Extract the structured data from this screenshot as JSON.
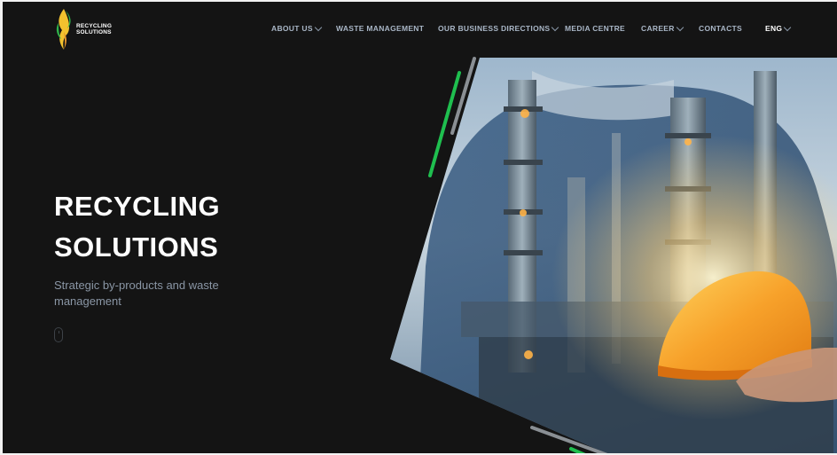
{
  "logo": {
    "line1": "RECYCLING",
    "line2": "SOLUTIONS",
    "icon": "leaf-flame-icon"
  },
  "nav": {
    "items": [
      {
        "label": "ABOUT US",
        "dropdown": true
      },
      {
        "label": "WASTE MANAGEMENT",
        "dropdown": false
      },
      {
        "label": "OUR BUSINESS DIRECTIONS",
        "dropdown": true
      },
      {
        "label": "MEDIA CENTRE",
        "dropdown": false
      },
      {
        "label": "CAREER",
        "dropdown": true
      },
      {
        "label": "CONTACTS",
        "dropdown": false
      }
    ],
    "language": "ENG"
  },
  "hero": {
    "title_line1": "RECYCLING",
    "title_line2": "SOLUTIONS",
    "subtitle": "Strategic by-products and waste management",
    "scroll_icon": "mouse-scroll-icon",
    "image": "worker-with-hard-hat-over-refinery-double-exposure"
  },
  "colors": {
    "background": "#141414",
    "nav_text": "#a9b6c6",
    "accent_green": "#22c55e",
    "subtitle_text": "#8a96a5",
    "hardhat_orange": "#f5a623"
  }
}
